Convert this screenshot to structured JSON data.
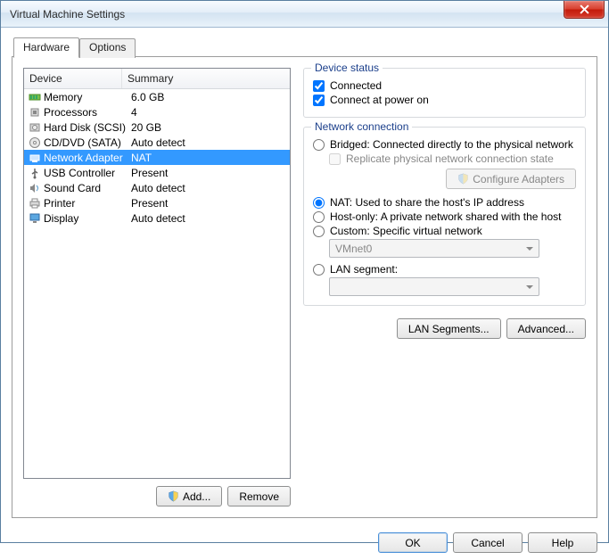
{
  "window": {
    "title": "Virtual Machine Settings"
  },
  "tabs": {
    "hardware": "Hardware",
    "options": "Options",
    "active": "hardware"
  },
  "device_list": {
    "col_device": "Device",
    "col_summary": "Summary",
    "rows": [
      {
        "icon": "memory-icon",
        "device": "Memory",
        "summary": "6.0 GB"
      },
      {
        "icon": "cpu-icon",
        "device": "Processors",
        "summary": "4"
      },
      {
        "icon": "disk-icon",
        "device": "Hard Disk (SCSI)",
        "summary": "20 GB"
      },
      {
        "icon": "cd-icon",
        "device": "CD/DVD (SATA)",
        "summary": "Auto detect"
      },
      {
        "icon": "network-icon",
        "device": "Network Adapter",
        "summary": "NAT",
        "selected": true
      },
      {
        "icon": "usb-icon",
        "device": "USB Controller",
        "summary": "Present"
      },
      {
        "icon": "sound-icon",
        "device": "Sound Card",
        "summary": "Auto detect"
      },
      {
        "icon": "printer-icon",
        "device": "Printer",
        "summary": "Present"
      },
      {
        "icon": "display-icon",
        "device": "Display",
        "summary": "Auto detect"
      }
    ],
    "add_label": "Add...",
    "remove_label": "Remove"
  },
  "device_status": {
    "legend": "Device status",
    "connected": {
      "label": "Connected",
      "checked": true
    },
    "connect_power": {
      "label": "Connect at power on",
      "checked": true
    }
  },
  "network_connection": {
    "legend": "Network connection",
    "bridged": {
      "label": "Bridged: Connected directly to the physical network"
    },
    "replicate": {
      "label": "Replicate physical network connection state",
      "disabled": true
    },
    "configure_adapters": "Configure Adapters",
    "nat": {
      "label": "NAT: Used to share the host's IP address",
      "selected": true
    },
    "hostonly": {
      "label": "Host-only: A private network shared with the host"
    },
    "custom": {
      "label": "Custom: Specific virtual network"
    },
    "custom_value": "VMnet0",
    "lan": {
      "label": "LAN segment:"
    },
    "lan_value": ""
  },
  "right_buttons": {
    "lan_segments": "LAN Segments...",
    "advanced": "Advanced..."
  },
  "footer": {
    "ok": "OK",
    "cancel": "Cancel",
    "help": "Help"
  }
}
